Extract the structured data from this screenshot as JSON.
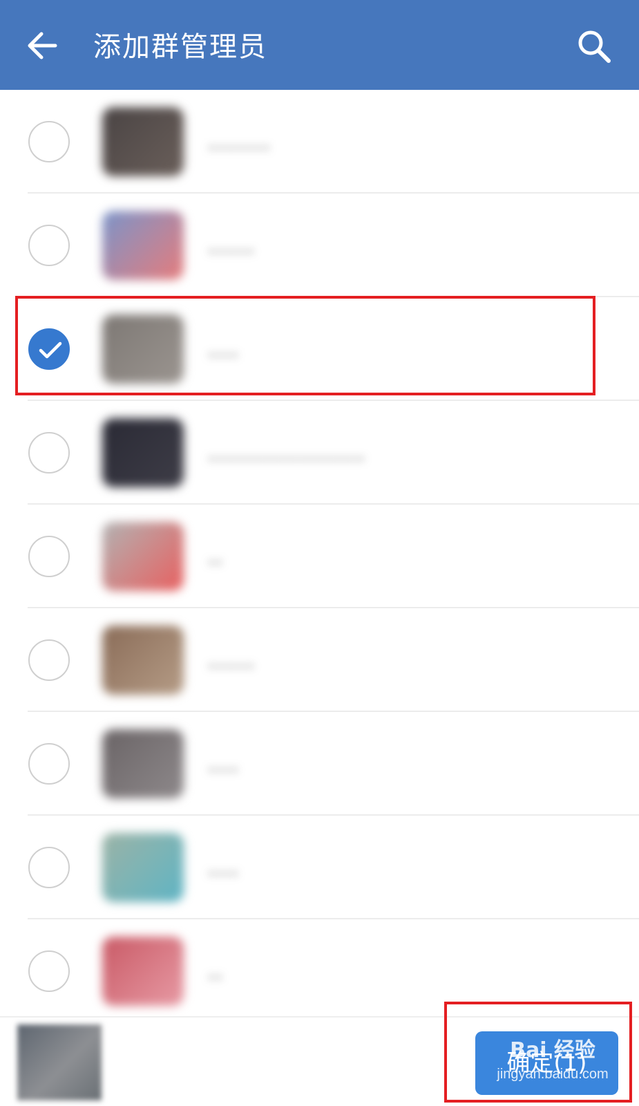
{
  "header": {
    "title": "添加群管理员",
    "back_icon": "arrow-left-icon",
    "search_icon": "search-icon",
    "background": "#4677bd"
  },
  "contacts": [
    {
      "checked": false,
      "avatar_colors": [
        "#4a4444",
        "#6a5f5a"
      ],
      "name": "........"
    },
    {
      "checked": false,
      "avatar_colors": [
        "#7b94c9",
        "#e67c7c"
      ],
      "name": "......"
    },
    {
      "checked": true,
      "avatar_colors": [
        "#7d7874",
        "#9b9590"
      ],
      "name": "...."
    },
    {
      "checked": false,
      "avatar_colors": [
        "#2a2a35",
        "#3e3d47"
      ],
      "name": "...................."
    },
    {
      "checked": false,
      "avatar_colors": [
        "#b2b2b2",
        "#e86060"
      ],
      "name": ".."
    },
    {
      "checked": false,
      "avatar_colors": [
        "#8a6c58",
        "#b59c86"
      ],
      "name": "......"
    },
    {
      "checked": false,
      "avatar_colors": [
        "#6a6466",
        "#8e898b"
      ],
      "name": "...."
    },
    {
      "checked": false,
      "avatar_colors": [
        "#9bb3a6",
        "#5fb4c4"
      ],
      "name": "...."
    },
    {
      "checked": false,
      "avatar_colors": [
        "#c95a66",
        "#e79aa4"
      ],
      "name": ".."
    }
  ],
  "bottom": {
    "confirm_label": "确定(1)",
    "confirm_color": "#3a86dd"
  },
  "watermark": {
    "top": "Bai 经验",
    "bottom": "jingyan.baidu.com"
  },
  "annotation_color": "#e41f22"
}
